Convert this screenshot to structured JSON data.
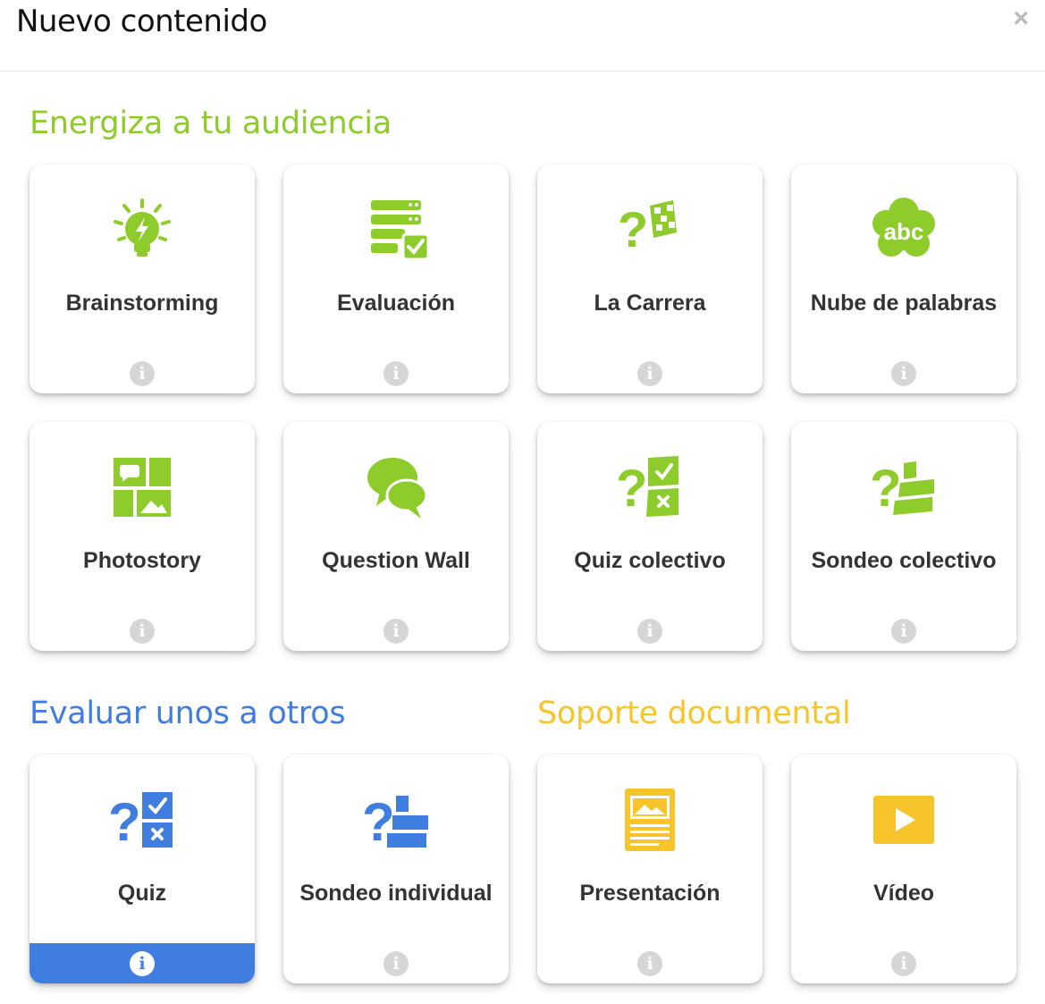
{
  "header": {
    "title": "Nuevo contenido",
    "close_label": "×"
  },
  "sections": {
    "energiza": {
      "title": "Energiza a tu audiencia",
      "color": "#8dcc2a"
    },
    "evaluar": {
      "title": "Evaluar unos a otros",
      "color": "#3f7de0"
    },
    "soporte": {
      "title": "Soporte documental",
      "color": "#f7c52b"
    }
  },
  "cards": {
    "brainstorming": {
      "label": "Brainstorming",
      "icon": "lightbulb-icon"
    },
    "evaluacion": {
      "label": "Evaluación",
      "icon": "checklist-icon"
    },
    "la_carrera": {
      "label": "La Carrera",
      "icon": "race-flag-question-icon"
    },
    "nube": {
      "label": "Nube de palabras",
      "icon": "cloud-abc-icon",
      "icon_text": "abc"
    },
    "photostory": {
      "label": "Photostory",
      "icon": "photo-grid-icon"
    },
    "question_wall": {
      "label": "Question Wall",
      "icon": "speech-bubbles-icon"
    },
    "quiz_colectivo": {
      "label": "Quiz colectivo",
      "icon": "quiz-check-cross-icon"
    },
    "sondeo_colectivo": {
      "label": "Sondeo colectivo",
      "icon": "poll-bars-icon"
    },
    "quiz": {
      "label": "Quiz",
      "icon": "quiz-check-cross-icon"
    },
    "sondeo_individual": {
      "label": "Sondeo individual",
      "icon": "poll-bars-icon"
    },
    "presentacion": {
      "label": "Presentación",
      "icon": "document-icon"
    },
    "video": {
      "label": "Vídeo",
      "icon": "play-icon"
    }
  },
  "info_glyph": "i",
  "colors": {
    "green": "#8dcc2a",
    "blue": "#3f7de0",
    "yellow": "#f7c52b",
    "info_gray": "#d6d6d6"
  }
}
